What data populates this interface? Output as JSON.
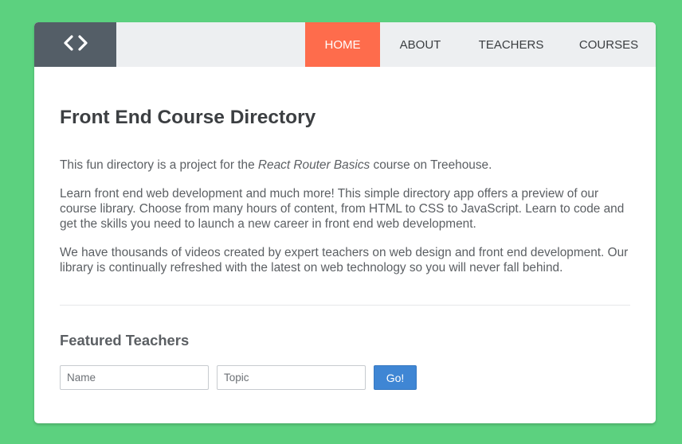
{
  "header": {
    "logo_icon": "code-brackets-icon",
    "nav": [
      {
        "label": "HOME",
        "active": true
      },
      {
        "label": "ABOUT",
        "active": false
      },
      {
        "label": "TEACHERS",
        "active": false
      },
      {
        "label": "COURSES",
        "active": false
      }
    ]
  },
  "main": {
    "title": "Front End Course Directory",
    "intro": {
      "before": "This fun directory is a project for the ",
      "emphasis": "React Router Basics",
      "after": " course on Treehouse."
    },
    "paragraph_2": "Learn front end web development and much more! This simple directory app offers a preview of our course library. Choose from many hours of content, from HTML to CSS to JavaScript. Learn to code and get the skills you need to launch a new career in front end web development.",
    "paragraph_3": "We have thousands of videos created by expert teachers on web design and front end development. Our library is continually refreshed with the latest on web technology so you will never fall behind.",
    "featured_title": "Featured Teachers",
    "form": {
      "name_placeholder": "Name",
      "topic_placeholder": "Topic",
      "submit_label": "Go!"
    }
  },
  "colors": {
    "background": "#5cd17f",
    "header": "#edeff1",
    "logo": "#545e67",
    "nav_active": "#fe6c4c",
    "button": "#3f86d4"
  }
}
